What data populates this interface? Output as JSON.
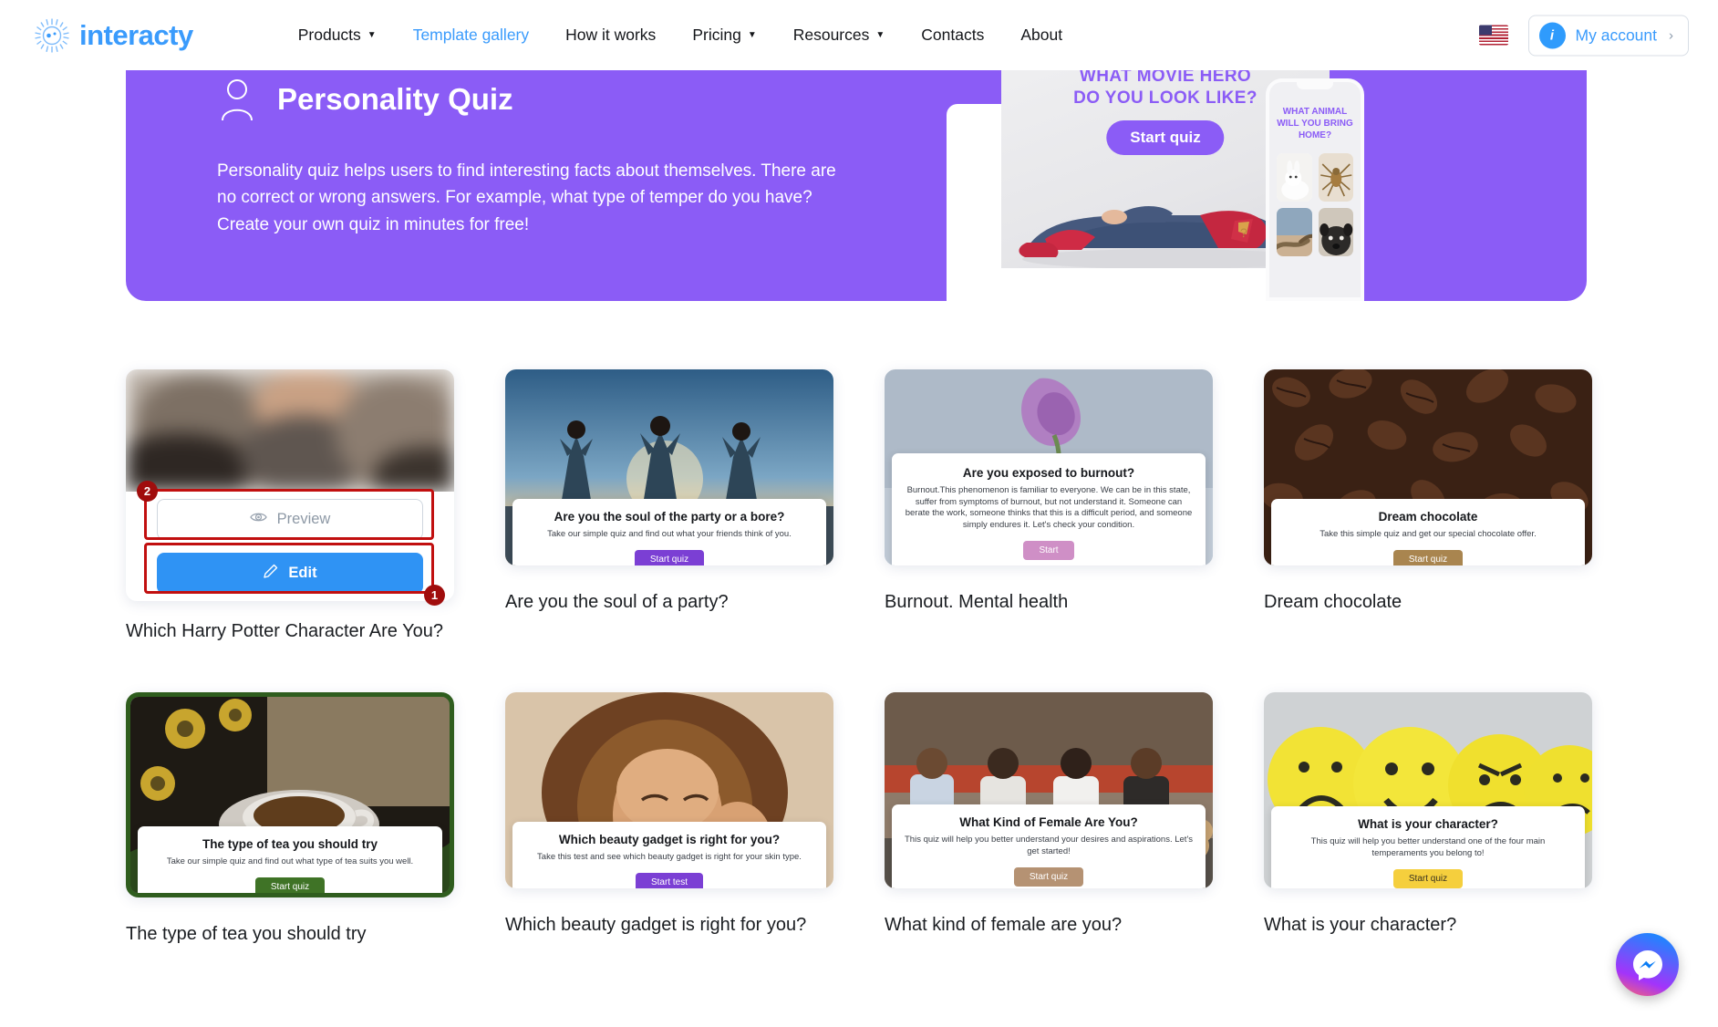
{
  "header": {
    "logo_text": "interacty",
    "logo_icon": "interacty-sun-logo-icon",
    "nav": [
      {
        "label": "Products",
        "has_caret": true,
        "active": false
      },
      {
        "label": "Template gallery",
        "has_caret": false,
        "active": true
      },
      {
        "label": "How it works",
        "has_caret": false,
        "active": false
      },
      {
        "label": "Pricing",
        "has_caret": true,
        "active": false
      },
      {
        "label": "Resources",
        "has_caret": true,
        "active": false
      },
      {
        "label": "Contacts",
        "has_caret": false,
        "active": false
      },
      {
        "label": "About",
        "has_caret": false,
        "active": false
      }
    ],
    "language_flag": "us-flag-icon",
    "account_label": "My account",
    "account_avatar_letter": "i",
    "account_chevron": "›"
  },
  "hero": {
    "icon": "person-outline-icon",
    "title": "Personality Quiz",
    "description": "Personality quiz helps users to find interesting facts about themselves. There are no correct or wrong answers. For example, what type of temper do you have? Create your own quiz in minutes for free!",
    "background_color": "#8b5cf6",
    "promo_card": {
      "title": "WHAT MOVIE HERO\nDO YOU LOOK LIKE?",
      "button_label": "Start quiz"
    },
    "phone_card": {
      "title": "WHAT ANIMAL WILL YOU BRING HOME?",
      "tiles": [
        "white-rabbit-photo",
        "spider-photo",
        "snake-photo",
        "pug-dog-photo"
      ]
    }
  },
  "annotations": [
    {
      "id": "1",
      "target": "edit-button"
    },
    {
      "id": "2",
      "target": "preview-button"
    }
  ],
  "cards": [
    {
      "title": "Which Harry Potter Character Are You?",
      "state": "hovered",
      "preview_label": "Preview",
      "preview_icon": "eye-icon",
      "edit_label": "Edit",
      "edit_icon": "pencil-icon",
      "edit_color": "#2f93f4"
    },
    {
      "title": "Are you the soul of a party?",
      "mini_title": "Are you the soul of the party or a bore?",
      "mini_desc": "Take our simple quiz and find out what your friends think of you.",
      "mini_btn": "Start quiz",
      "mini_btn_color": "#7b3fd4",
      "thumb": "three-friends-at-sunset-photo"
    },
    {
      "title": "Burnout. Mental health",
      "mini_title": "Are you exposed to burnout?",
      "mini_desc": "Burnout.This phenomenon is familiar to everyone. We can be in this state, suffer from symptoms of burnout, but not understand it. Someone can berate the work, someone thinks that this is a difficult period, and someone simply endures it. Let's check your condition.",
      "mini_btn": "Start",
      "mini_btn_color": "#cf8fc6",
      "thumb": "wilted-purple-rose-photo"
    },
    {
      "title": "Dream chocolate",
      "mini_title": "Dream chocolate",
      "mini_desc": "Take this simple quiz and get our special chocolate offer.",
      "mini_btn": "Start quiz",
      "mini_btn_color": "#a9854f",
      "thumb": "coffee-beans-photo"
    },
    {
      "title": "The type of tea you should try",
      "mini_title": "The type of tea you should try",
      "mini_desc": "Take our simple quiz and find out what type of tea suits you well.",
      "mini_btn": "Start quiz",
      "mini_btn_color": "#3f7326",
      "thumb": "tea-cup-with-flowers-photo"
    },
    {
      "title": "Which beauty gadget is right for you?",
      "mini_title": "Which beauty gadget is right for you?",
      "mini_desc": "Take this test and see which beauty gadget is right for your skin type.",
      "mini_btn": "Start test",
      "mini_btn_color": "#7b3fd4",
      "thumb": "woman-with-curly-hair-photo"
    },
    {
      "title": "What kind of female are you?",
      "mini_title": "What Kind of Female Are You?",
      "mini_desc": "This quiz will help you better understand your desires and aspirations. Let's get started!",
      "mini_btn": "Start quiz",
      "mini_btn_color": "#b59273",
      "thumb": "four-women-with-dog-photo"
    },
    {
      "title": "What is your character?",
      "mini_title": "What is your character?",
      "mini_desc": "This quiz will help you better understand one of the four main temperaments you belong to!",
      "mini_btn": "Start quiz",
      "mini_btn_color": "#f5cf3d",
      "thumb": "emoji-balls-photo"
    }
  ],
  "messenger": {
    "icon": "messenger-icon",
    "label": "Messenger chat"
  }
}
